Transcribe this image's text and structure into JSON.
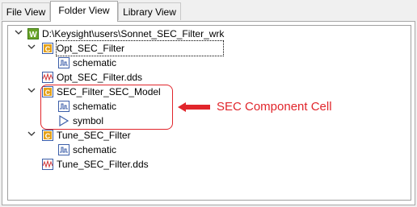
{
  "tabs": [
    {
      "label": "File View"
    },
    {
      "label": "Folder View"
    },
    {
      "label": "Library View"
    }
  ],
  "active_tab": "Folder View",
  "tree": {
    "workspace": "D:\\Keysight\\users\\Sonnet_SEC_Filter_wrk",
    "cell1": "Opt_SEC_Filter",
    "cell1_view1": "schematic",
    "file1": "Opt_SEC_Filter.dds",
    "cell2": "SEC_Filter_SEC_Model",
    "cell2_view1": "schematic",
    "cell2_view2": "symbol",
    "cell3": "Tune_SEC_Filter",
    "cell3_view1": "schematic",
    "file2": "Tune_SEC_Filter.dds"
  },
  "annotation": {
    "text": "SEC Component Cell",
    "color": "#e1252b"
  },
  "colors": {
    "workspace_icon": "#6aa329",
    "cell_icon": "#e5a21a",
    "view_icon": "#3b5ea8"
  },
  "icons": {
    "expander": "chevron-down-icon",
    "workspace": "workspace-w-icon",
    "cell": "cell-c-icon",
    "schematic": "schematic-icon",
    "symbol": "symbol-triangle-icon",
    "dds": "dds-waveform-icon"
  }
}
